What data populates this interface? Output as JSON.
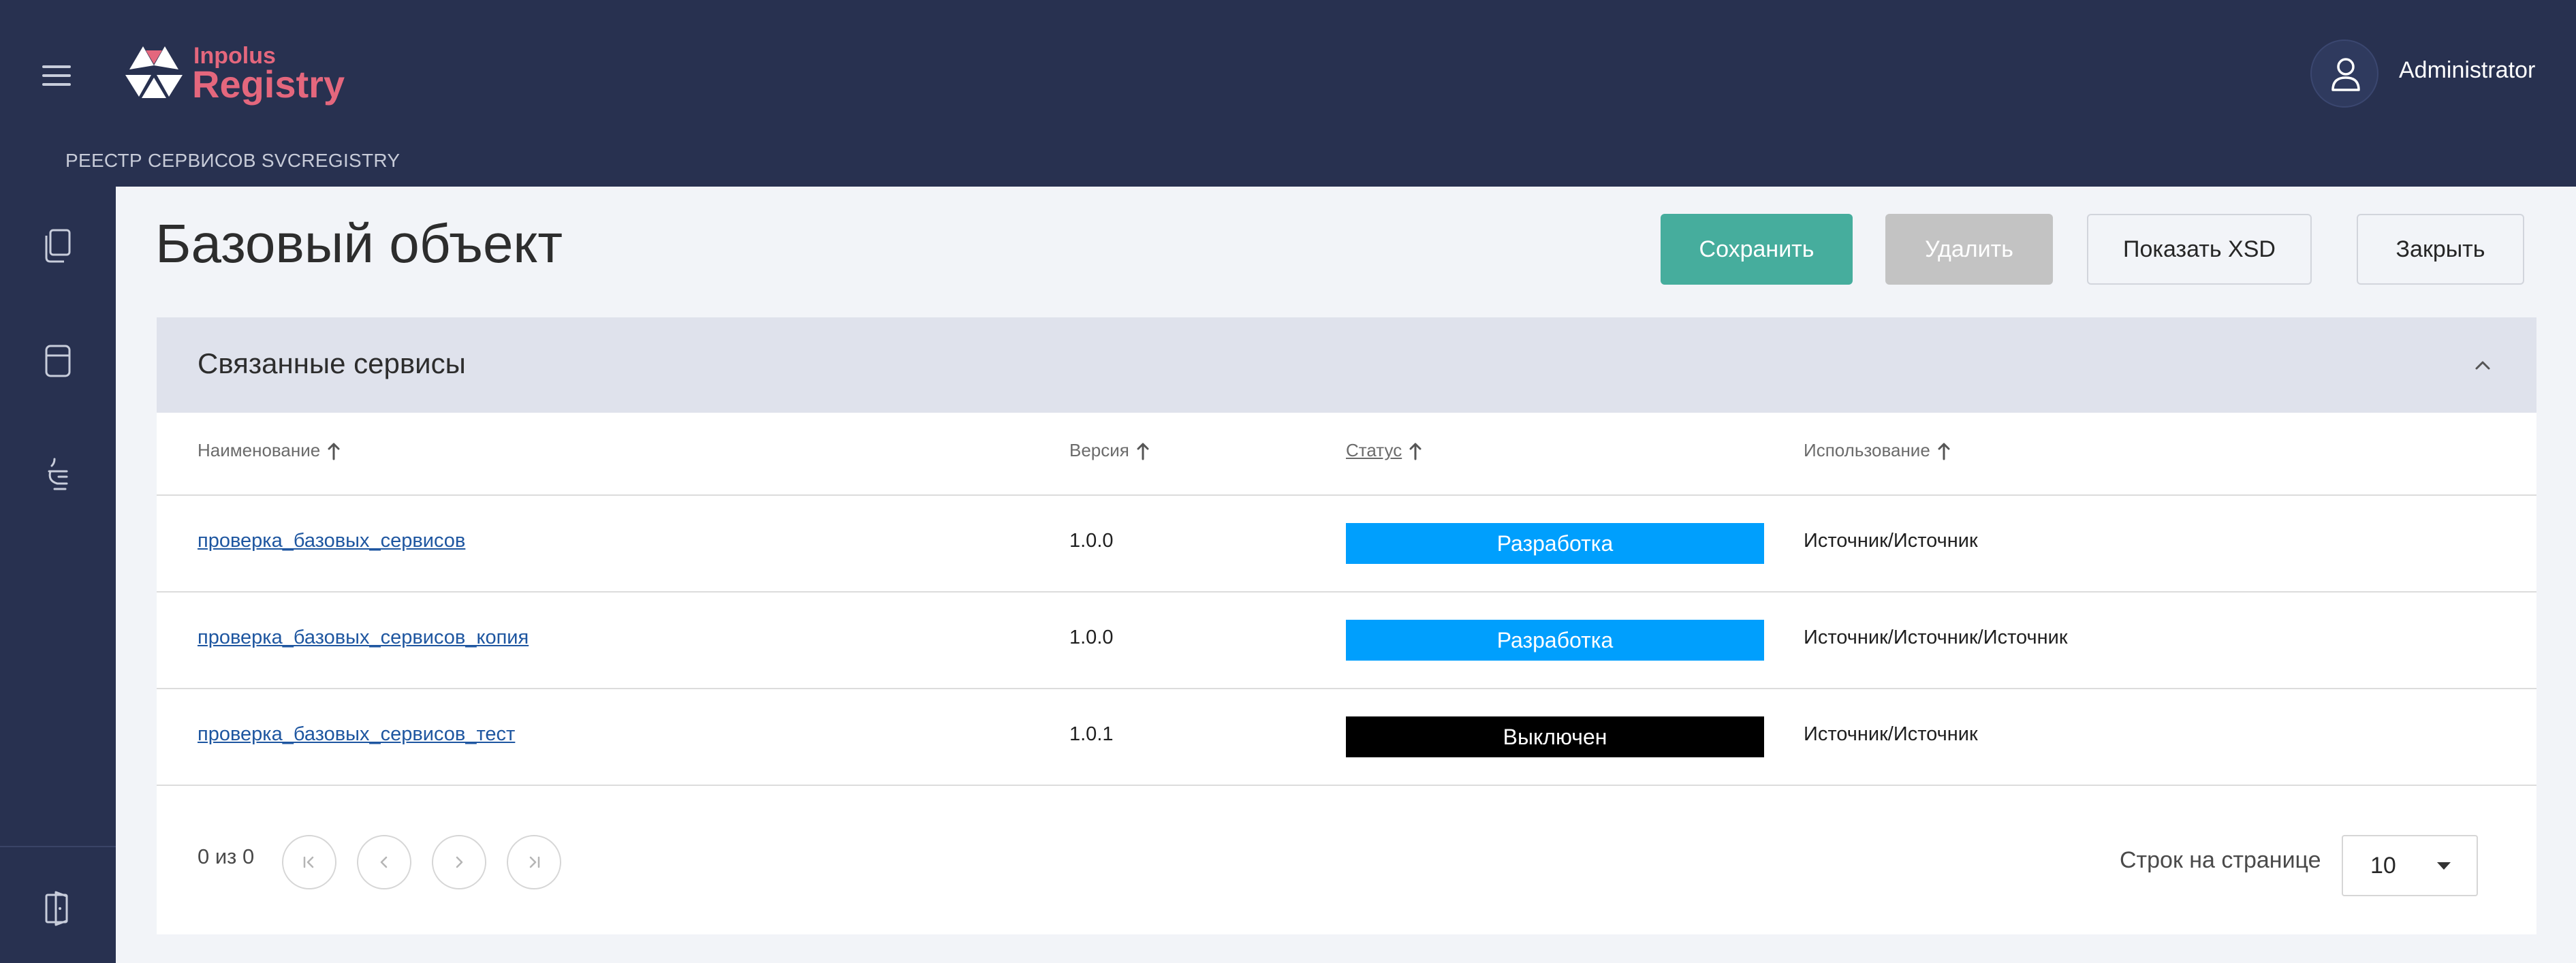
{
  "header": {
    "brand_small": "Inpolus",
    "brand_big": "Registry",
    "breadcrumb": "РЕЕСТР СЕРВИСОВ SVCREGISTRY",
    "user_name": "Administrator"
  },
  "sidebar": {
    "items": [
      {
        "icon": "documents-icon"
      },
      {
        "icon": "database-icon"
      },
      {
        "icon": "service-icon"
      },
      {
        "icon": "logout-icon"
      }
    ]
  },
  "page": {
    "title": "Базовый объект",
    "buttons": {
      "save": "Сохранить",
      "delete": "Удалить",
      "show_xsd": "Показать XSD",
      "close": "Закрыть"
    }
  },
  "panel": {
    "title": "Связанные сервисы",
    "columns": [
      "Наименование",
      "Версия",
      "Статус",
      "Использование"
    ],
    "rows": [
      {
        "name": "проверка_базовых_сервисов",
        "version": "1.0.0",
        "status": "Разработка",
        "usage": "Источник/Источник"
      },
      {
        "name": "проверка_базовых_сервисов_копия",
        "version": "1.0.0",
        "status": "Разработка",
        "usage": "Источник/Источник/Источник"
      },
      {
        "name": "проверка_базовых_сервисов_тест",
        "version": "1.0.1",
        "status": "Выключен",
        "usage": "Источник/Источник"
      }
    ],
    "pagination": {
      "range_text": "0 из 0",
      "rows_per_page_label": "Строк на странице",
      "rows_per_page_value": "10"
    }
  },
  "colors": {
    "header_bg": "#283150",
    "brand": "#e4677d",
    "save_button": "#46ad9d",
    "delete_button": "#c3c3c3",
    "status_development": "#009ffd",
    "status_disabled": "#000000"
  }
}
